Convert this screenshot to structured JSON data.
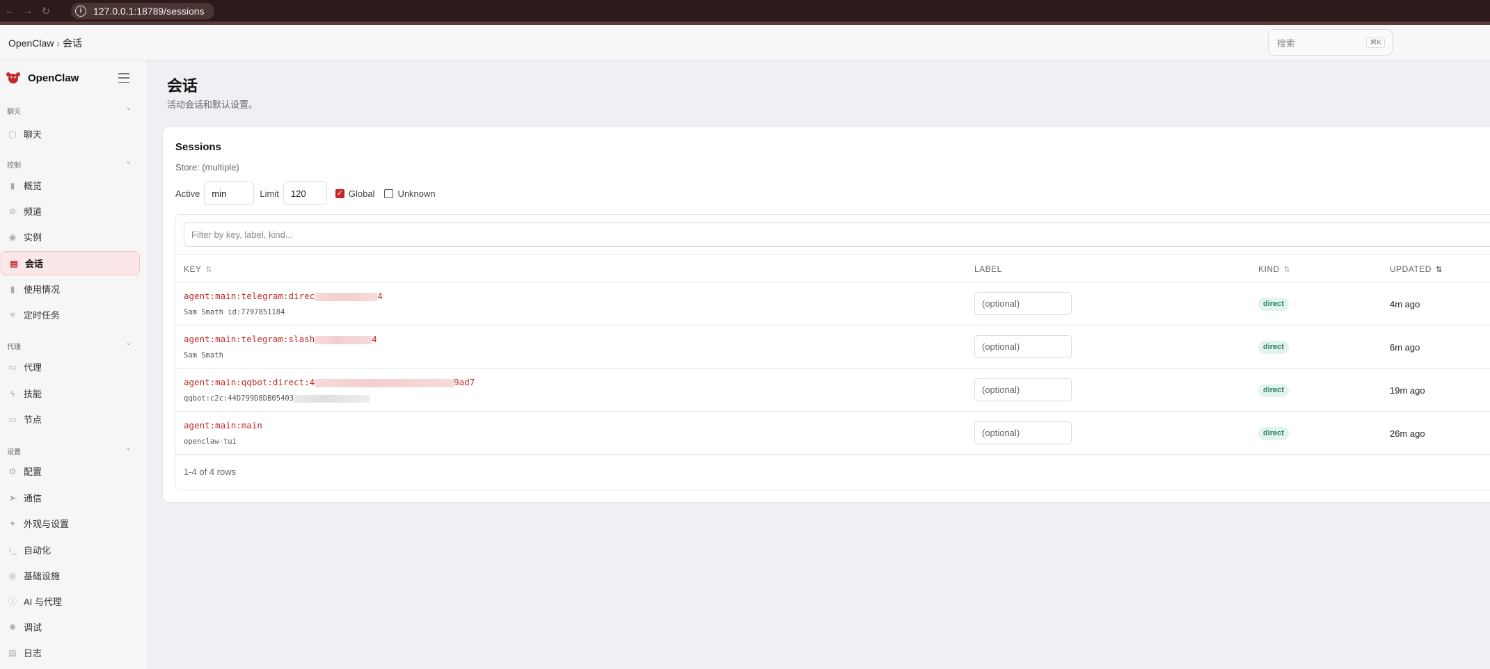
{
  "browser": {
    "url": "127.0.0.1:18789/sessions"
  },
  "breadcrumb": {
    "root": "OpenClaw",
    "separator": "›",
    "current": "会话"
  },
  "search": {
    "placeholder": "搜索",
    "shortcut": "⌘K"
  },
  "sidebar": {
    "brand": "OpenClaw",
    "groups": [
      {
        "label": "聊天",
        "items": [
          {
            "label": "聊天",
            "icon": "chat-icon"
          }
        ]
      },
      {
        "label": "控制",
        "items": [
          {
            "label": "概览",
            "icon": "bar-chart-icon"
          },
          {
            "label": "频道",
            "icon": "link-icon"
          },
          {
            "label": "实例",
            "icon": "radio-icon"
          },
          {
            "label": "会话",
            "icon": "file-icon",
            "active": true
          },
          {
            "label": "使用情况",
            "icon": "bar-chart-icon"
          },
          {
            "label": "定时任务",
            "icon": "loader-icon"
          }
        ]
      },
      {
        "label": "代理",
        "items": [
          {
            "label": "代理",
            "icon": "folder-icon"
          },
          {
            "label": "技能",
            "icon": "zap-icon"
          },
          {
            "label": "节点",
            "icon": "monitor-icon"
          }
        ]
      },
      {
        "label": "设置",
        "items": [
          {
            "label": "配置",
            "icon": "gear-icon"
          },
          {
            "label": "通信",
            "icon": "send-icon"
          },
          {
            "label": "外观与设置",
            "icon": "sparkle-icon"
          },
          {
            "label": "自动化",
            "icon": "terminal-icon"
          },
          {
            "label": "基础设施",
            "icon": "globe-icon"
          },
          {
            "label": "AI 与代理",
            "icon": "info-icon"
          },
          {
            "label": "调试",
            "icon": "bug-icon"
          },
          {
            "label": "日志",
            "icon": "scroll-icon"
          }
        ]
      }
    ]
  },
  "page": {
    "title": "会话",
    "subtitle": "活动会话和默认设置。"
  },
  "sessions": {
    "title": "Sessions",
    "store": "Store: (multiple)",
    "active_label": "Active",
    "active_value": "min",
    "limit_label": "Limit",
    "limit_value": "120",
    "global_label": "Global",
    "global_checked": true,
    "unknown_label": "Unknown",
    "unknown_checked": false,
    "filter_placeholder": "Filter by key, label, kind...",
    "columns": {
      "key": "KEY",
      "label": "LABEL",
      "kind": "KIND",
      "updated": "UPDATED"
    },
    "label_placeholder": "(optional)",
    "rows": [
      {
        "key_start": "agent:main:telegram:direc",
        "key_end": "4",
        "sub": "Sam Smath id:7797851184",
        "kind": "direct",
        "updated": "4m ago"
      },
      {
        "key_start": "agent:main:telegram:slash",
        "key_end": "4",
        "sub": "Sam Smath",
        "kind": "direct",
        "updated": "6m ago"
      },
      {
        "key_start": "agent:main:qqbot:direct:4",
        "key_end": "9ad7",
        "sub": "qqbot:c2c:44D799D8DB05403",
        "kind": "direct",
        "updated": "19m ago"
      },
      {
        "key_start": "agent:main:main",
        "key_end": "",
        "sub": "openclaw-tui",
        "kind": "direct",
        "updated": "26m ago"
      }
    ],
    "row_count": "1-4 of 4 rows"
  },
  "colors": {
    "accent": "#c62828",
    "badge_bg": "#e3f3ee",
    "badge_text": "#1e7a5c",
    "chrome": "#2e1a1a"
  }
}
